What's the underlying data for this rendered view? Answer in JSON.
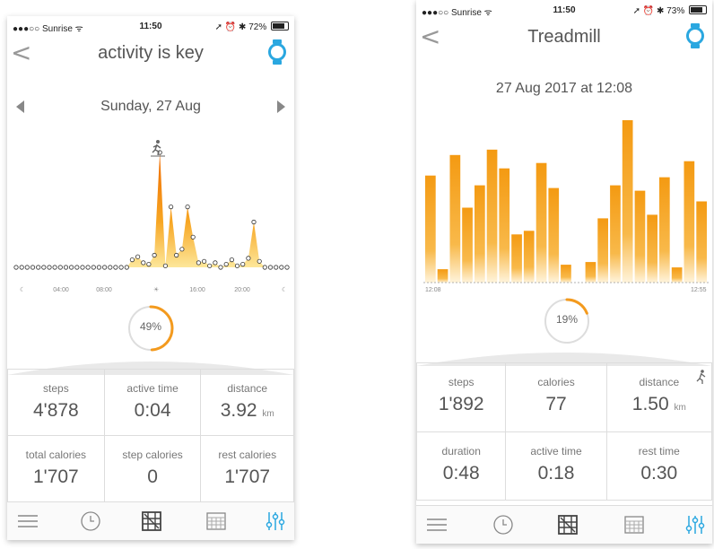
{
  "left": {
    "status": {
      "carrier": "●●●○○ Sunrise ᯤ",
      "time": "11:50",
      "right": "➚ ⏰ ✱ 72%",
      "battery": 0.72
    },
    "nav": {
      "back": "<",
      "title": "activity is key",
      "watch_icon": "watch-icon"
    },
    "date": "Sunday, 27 Aug",
    "chart_data": {
      "type": "area",
      "xticks": [
        "04:00",
        "08:00",
        "16:00",
        "20:00"
      ],
      "points": [
        0,
        0,
        0,
        0,
        0,
        0,
        0,
        0,
        0,
        0,
        0,
        0,
        0,
        0,
        0,
        0,
        0,
        0,
        0,
        0,
        0,
        0.5,
        0.7,
        0.3,
        0.2,
        0.8,
        7.6,
        0.1,
        4.0,
        0.8,
        1.2,
        4.0,
        2.0,
        0.3,
        0.4,
        0.1,
        0.3,
        0,
        0.2,
        0.5,
        0.1,
        0.2,
        0.6,
        3.0,
        0.4,
        0,
        0,
        0,
        0,
        0
      ]
    },
    "ring": {
      "percent": 0.49,
      "label": "49%"
    },
    "stats": [
      {
        "label": "steps",
        "value": "4'878",
        "unit": ""
      },
      {
        "label": "active time",
        "value": "0:04",
        "unit": ""
      },
      {
        "label": "distance",
        "value": "3.92",
        "unit": "km"
      },
      {
        "label": "total calories",
        "value": "1'707",
        "unit": ""
      },
      {
        "label": "step calories",
        "value": "0",
        "unit": ""
      },
      {
        "label": "rest calories",
        "value": "1'707",
        "unit": ""
      }
    ],
    "tabs": [
      "menu-icon",
      "clock-icon",
      "activity-map-icon",
      "calendar-icon",
      "settings-sliders-icon"
    ]
  },
  "right": {
    "status": {
      "carrier": "●●●○○ Sunrise ᯤ",
      "time": "11:50",
      "right": "➚ ⏰ ✱ 73%",
      "battery": 0.73
    },
    "nav": {
      "back": "<",
      "title": "Treadmill",
      "watch_icon": "watch-icon"
    },
    "date": "27 Aug 2017 at 12:08",
    "chart_data": {
      "type": "bar",
      "x_start": "12:08",
      "x_end": "12:55",
      "values": [
        12.0,
        1.5,
        14.3,
        8.4,
        10.9,
        14.9,
        12.8,
        5.4,
        5.8,
        13.4,
        10.6,
        2.0,
        0,
        2.3,
        7.2,
        10.9,
        18.2,
        10.3,
        7.6,
        11.8,
        1.7,
        13.6,
        9.1
      ]
    },
    "ring": {
      "percent": 0.19,
      "label": "19%"
    },
    "stats": [
      {
        "label": "steps",
        "value": "1'892",
        "unit": ""
      },
      {
        "label": "calories",
        "value": "77",
        "unit": ""
      },
      {
        "label": "distance",
        "value": "1.50",
        "unit": "km"
      },
      {
        "label": "duration",
        "value": "0:48",
        "unit": ""
      },
      {
        "label": "active time",
        "value": "0:18",
        "unit": ""
      },
      {
        "label": "rest time",
        "value": "0:30",
        "unit": ""
      }
    ],
    "tabs": [
      "menu-icon",
      "clock-icon",
      "activity-map-icon",
      "calendar-icon",
      "settings-sliders-icon"
    ]
  }
}
